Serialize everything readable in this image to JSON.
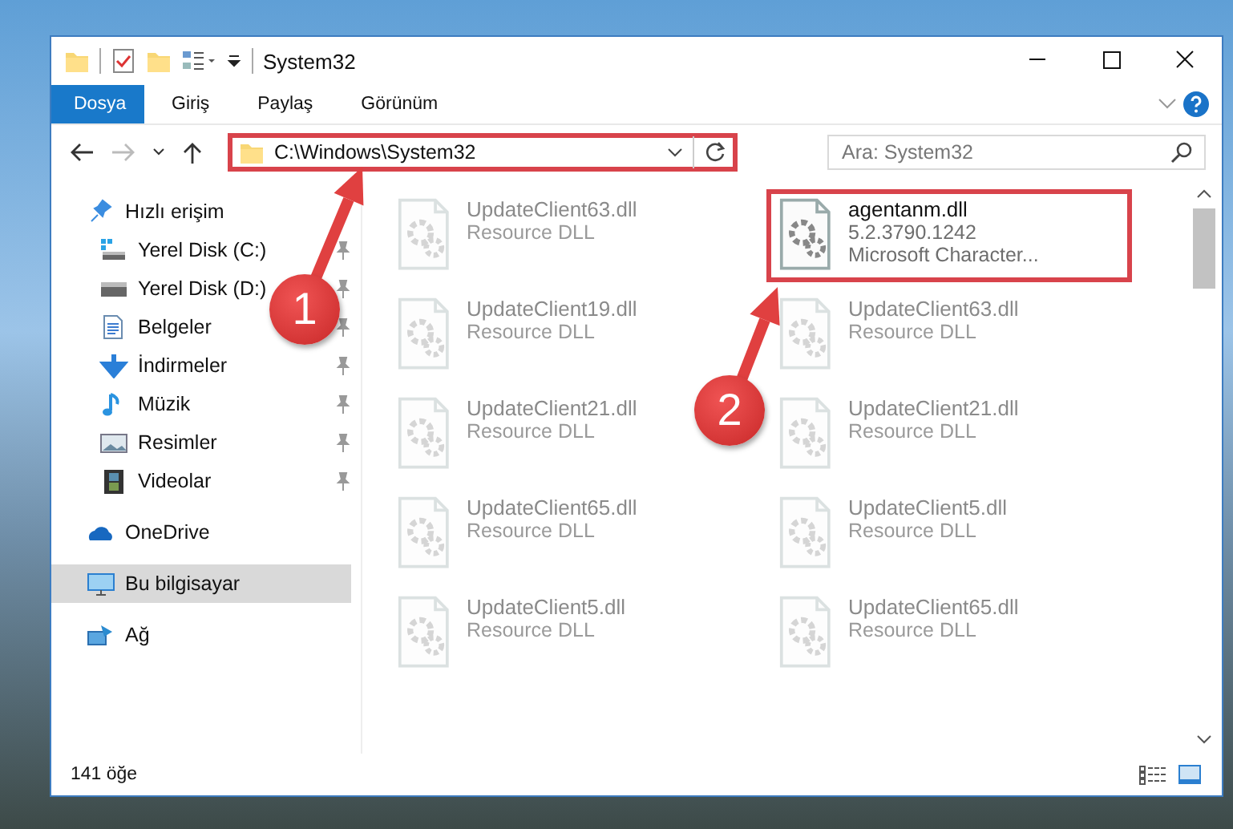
{
  "window": {
    "title": "System32"
  },
  "ribbon_tabs": [
    {
      "label": "Dosya",
      "selected": true
    },
    {
      "label": "Giriş",
      "selected": false
    },
    {
      "label": "Paylaş",
      "selected": false
    },
    {
      "label": "Görünüm",
      "selected": false
    }
  ],
  "address_bar": {
    "path": "C:\\Windows\\System32",
    "highlighted": true
  },
  "search": {
    "placeholder": "Ara: System32"
  },
  "sidebar": {
    "items": [
      {
        "label": "Hızlı erişim",
        "kind": "quick",
        "pinned": false,
        "selected": false
      },
      {
        "label": "Yerel Disk (C:)",
        "kind": "sysdrive",
        "pinned": true,
        "selected": false
      },
      {
        "label": "Yerel Disk (D:)",
        "kind": "drive",
        "pinned": true,
        "selected": false
      },
      {
        "label": "Belgeler",
        "kind": "docs",
        "pinned": true,
        "selected": false
      },
      {
        "label": "İndirmeler",
        "kind": "downloads",
        "pinned": true,
        "selected": false
      },
      {
        "label": "Müzik",
        "kind": "music",
        "pinned": true,
        "selected": false
      },
      {
        "label": "Resimler",
        "kind": "pictures",
        "pinned": true,
        "selected": false
      },
      {
        "label": "Videolar",
        "kind": "videos",
        "pinned": true,
        "selected": false
      },
      {
        "label": "OneDrive",
        "kind": "cloud",
        "pinned": false,
        "selected": false
      },
      {
        "label": "Bu bilgisayar",
        "kind": "pc",
        "pinned": false,
        "selected": true
      },
      {
        "label": "Ağ",
        "kind": "network",
        "pinned": false,
        "selected": false
      }
    ]
  },
  "files": [
    {
      "name": "UpdateClient63.dll",
      "details": [
        "Resource DLL"
      ],
      "blurred": true,
      "highlighted": false
    },
    {
      "name": "agentanm.dll",
      "details": [
        "5.2.3790.1242",
        "Microsoft Character..."
      ],
      "blurred": false,
      "highlighted": true
    },
    {
      "name": "UpdateClient19.dll",
      "details": [
        "Resource DLL"
      ],
      "blurred": true,
      "highlighted": false
    },
    {
      "name": "UpdateClient63.dll",
      "details": [
        "Resource DLL"
      ],
      "blurred": true,
      "highlighted": false
    },
    {
      "name": "UpdateClient21.dll",
      "details": [
        "Resource DLL"
      ],
      "blurred": true,
      "highlighted": false
    },
    {
      "name": "UpdateClient21.dll",
      "details": [
        "Resource DLL"
      ],
      "blurred": true,
      "highlighted": false
    },
    {
      "name": "UpdateClient65.dll",
      "details": [
        "Resource DLL"
      ],
      "blurred": true,
      "highlighted": false
    },
    {
      "name": "UpdateClient5.dll",
      "details": [
        "Resource DLL"
      ],
      "blurred": true,
      "highlighted": false
    },
    {
      "name": "UpdateClient5.dll",
      "details": [
        "Resource DLL"
      ],
      "blurred": true,
      "highlighted": false
    },
    {
      "name": "UpdateClient65.dll",
      "details": [
        "Resource DLL"
      ],
      "blurred": true,
      "highlighted": false
    }
  ],
  "status_bar": {
    "count": "141 öğe"
  },
  "annotations": [
    {
      "number": "1"
    },
    {
      "number": "2"
    }
  ]
}
